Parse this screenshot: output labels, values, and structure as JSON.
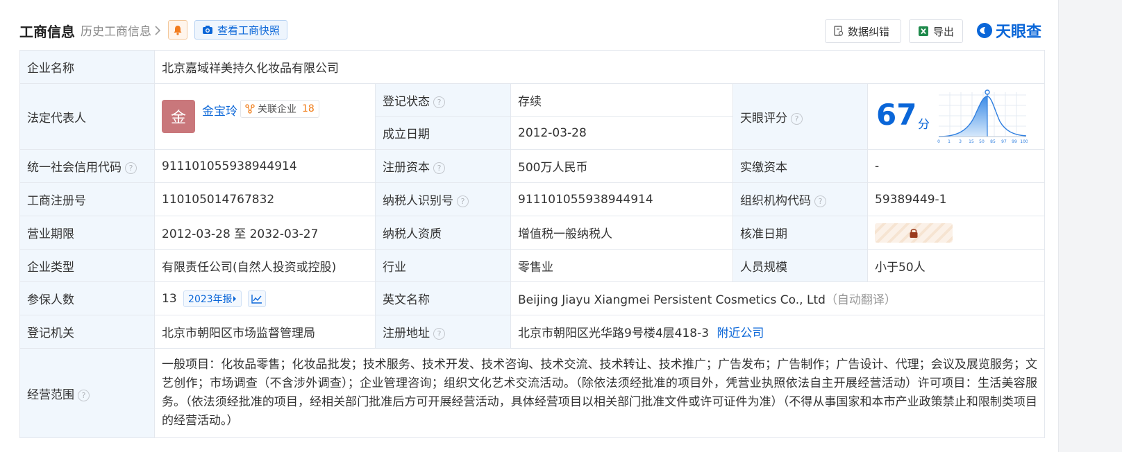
{
  "header": {
    "title": "工商信息",
    "history_link": "历史工商信息",
    "snapshot_label": "查看工商快照",
    "correction_label": "数据纠错",
    "export_label": "导出",
    "logo_text": "天眼查"
  },
  "company": {
    "name_label": "企业名称",
    "name": "北京嘉域祥美持久化妆品有限公司",
    "legal_rep_label": "法定代表人",
    "legal_rep_avatar": "金",
    "legal_rep_name": "金宝玲",
    "related_label": "关联企业",
    "related_count": "18",
    "status_label": "登记状态",
    "status": "存续",
    "founded_label": "成立日期",
    "founded": "2012-03-28",
    "score_label": "天眼评分",
    "score": "67",
    "score_unit": "分",
    "score_axis": [
      "0",
      "1",
      "3",
      "15",
      "50",
      "85",
      "97",
      "99",
      "100"
    ],
    "credit_code_label": "统一社会信用代码",
    "credit_code": "911101055938944914",
    "reg_capital_label": "注册资本",
    "reg_capital": "500万人民币",
    "paid_capital_label": "实缴资本",
    "paid_capital": "-",
    "reg_no_label": "工商注册号",
    "reg_no": "110105014767832",
    "taxpayer_id_label": "纳税人识别号",
    "taxpayer_id": "911101055938944914",
    "org_code_label": "组织机构代码",
    "org_code": "59389449-1",
    "term_label": "营业期限",
    "term": "2012-03-28 至 2032-03-27",
    "tax_qual_label": "纳税人资质",
    "tax_qual": "增值税一般纳税人",
    "approve_date_label": "核准日期",
    "type_label": "企业类型",
    "type": "有限责任公司(自然人投资或控股)",
    "industry_label": "行业",
    "industry": "零售业",
    "staff_label": "人员规模",
    "staff": "小于50人",
    "insured_label": "参保人数",
    "insured": "13",
    "insured_year": "2023年报",
    "en_name_label": "英文名称",
    "en_name": "Beijing Jiayu Xiangmei Persistent Cosmetics Co., Ltd",
    "en_name_note": "（自动翻译）",
    "authority_label": "登记机关",
    "authority": "北京市朝阳区市场监督管理局",
    "address_label": "注册地址",
    "address": "北京市朝阳区光华路9号楼4层418-3",
    "nearby_label": "附近公司",
    "scope_label": "经营范围",
    "scope": "一般项目：化妆品零售；化妆品批发；技术服务、技术开发、技术咨询、技术交流、技术转让、技术推广；广告发布；广告制作；广告设计、代理；会议及展览服务；文艺创作；市场调查（不含涉外调查）；企业管理咨询；组织文化艺术交流活动。（除依法须经批准的项目外，凭营业执照依法自主开展经营活动）许可项目：生活美容服务。（依法须经批准的项目，经相关部门批准后方可开展经营活动，具体经营项目以相关部门批准文件或许可证件为准）（不得从事国家和本市产业政策禁止和限制类项目的经营活动。）"
  },
  "colors": {
    "accent": "#0a66d8",
    "label_bg": "#f1f7fd",
    "status_green": "#16a34a",
    "related_orange": "#f07b16"
  }
}
